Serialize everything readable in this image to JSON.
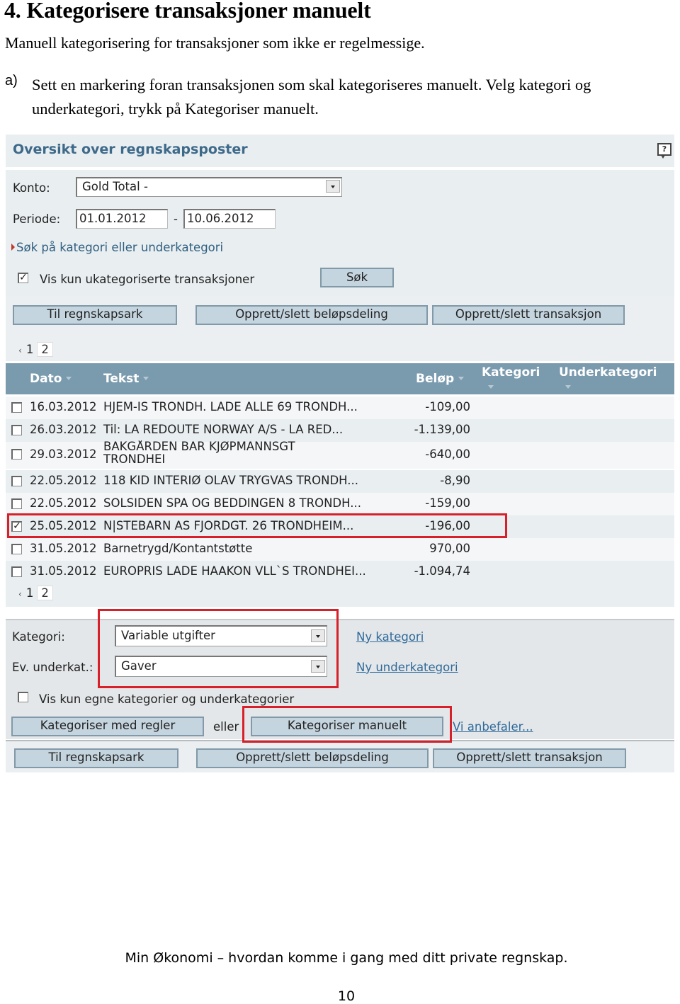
{
  "document": {
    "heading": "4. Kategorisere transaksjoner manuelt",
    "intro": "Manuell kategorisering for transaksjoner som ikke er regelmessige.",
    "step_marker": "a)",
    "step_text": "Sett en markering foran transaksjonen som skal kategoriseres manuelt. Velg kategori og underkategori, trykk på Kategoriser manuelt.",
    "footer": "Min Økonomi – hvordan komme i gang med ditt private regnskap.",
    "page_number": "10"
  },
  "app": {
    "panel_title": "Oversikt over regnskapsposter",
    "help_icon": "help-speech-bubble-icon",
    "filter": {
      "konto_label": "Konto:",
      "konto_value": "Gold Total -",
      "periode_label": "Periode:",
      "periode_from": "01.01.2012",
      "periode_sep": "-",
      "periode_to": "10.06.2012",
      "search_category_link": "Søk på kategori eller underkategori",
      "only_uncategorized_label": "Vis kun ukategoriserte transaksjoner",
      "only_uncategorized_checked": true,
      "search_button": "Søk"
    },
    "actions": {
      "to_sheet": "Til regnskapsark",
      "split_amount": "Opprett/slett beløpsdeling",
      "create_delete_tx": "Opprett/slett transaksjon"
    },
    "pager": {
      "prev": "‹",
      "pages": [
        "1",
        "2"
      ],
      "current": "2"
    },
    "table": {
      "columns": [
        "Dato",
        "Tekst",
        "Beløp",
        "Kategori",
        "Underkategori"
      ],
      "rows": [
        {
          "checked": false,
          "dato": "16.03.2012",
          "tekst": "HJEM-IS TRONDH. LADE ALLE 69 TRONDH...",
          "belop": "-109,00"
        },
        {
          "checked": false,
          "dato": "26.03.2012",
          "tekst": "Til: LA REDOUTE NORWAY A/S - LA RED...",
          "belop": "-1.139,00"
        },
        {
          "checked": false,
          "dato": "29.03.2012",
          "tekst": "BAKGÅRDEN BAR KJØPMANNSGT TRONDHEI",
          "belop": "-640,00"
        },
        {
          "checked": false,
          "dato": "22.05.2012",
          "tekst": "118 KID INTERIØ OLAV TRYGVAS TRONDH...",
          "belop": "-8,90"
        },
        {
          "checked": false,
          "dato": "22.05.2012",
          "tekst": "SOLSIDEN SPA OG BEDDINGEN 8 TRONDH...",
          "belop": "-159,00"
        },
        {
          "checked": true,
          "dato": "25.05.2012",
          "tekst": "N|STEBARN AS FJORDGT. 26 TRONDHEIM...",
          "belop": "-196,00"
        },
        {
          "checked": false,
          "dato": "31.05.2012",
          "tekst": "Barnetrygd/Kontantstøtte",
          "belop": "970,00"
        },
        {
          "checked": false,
          "dato": "31.05.2012",
          "tekst": "EUROPRIS LADE HAAKON VLL`S TRONDHEI...",
          "belop": "-1.094,74"
        }
      ]
    },
    "categorize": {
      "kategori_label": "Kategori:",
      "kategori_value": "Variable utgifter",
      "new_category_link": "Ny kategori",
      "underkat_label": "Ev. underkat.:",
      "underkat_value": "Gaver",
      "new_subcategory_link": "Ny underkategori",
      "own_only_label": "Vis kun egne kategorier og underkategorier",
      "own_only_checked": false,
      "by_rules_button": "Kategoriser med regler",
      "or_text": "eller",
      "manual_button": "Kategoriser manuelt",
      "recommend_link": "Vi anbefaler..."
    },
    "highlight_color": "#d8202a"
  }
}
